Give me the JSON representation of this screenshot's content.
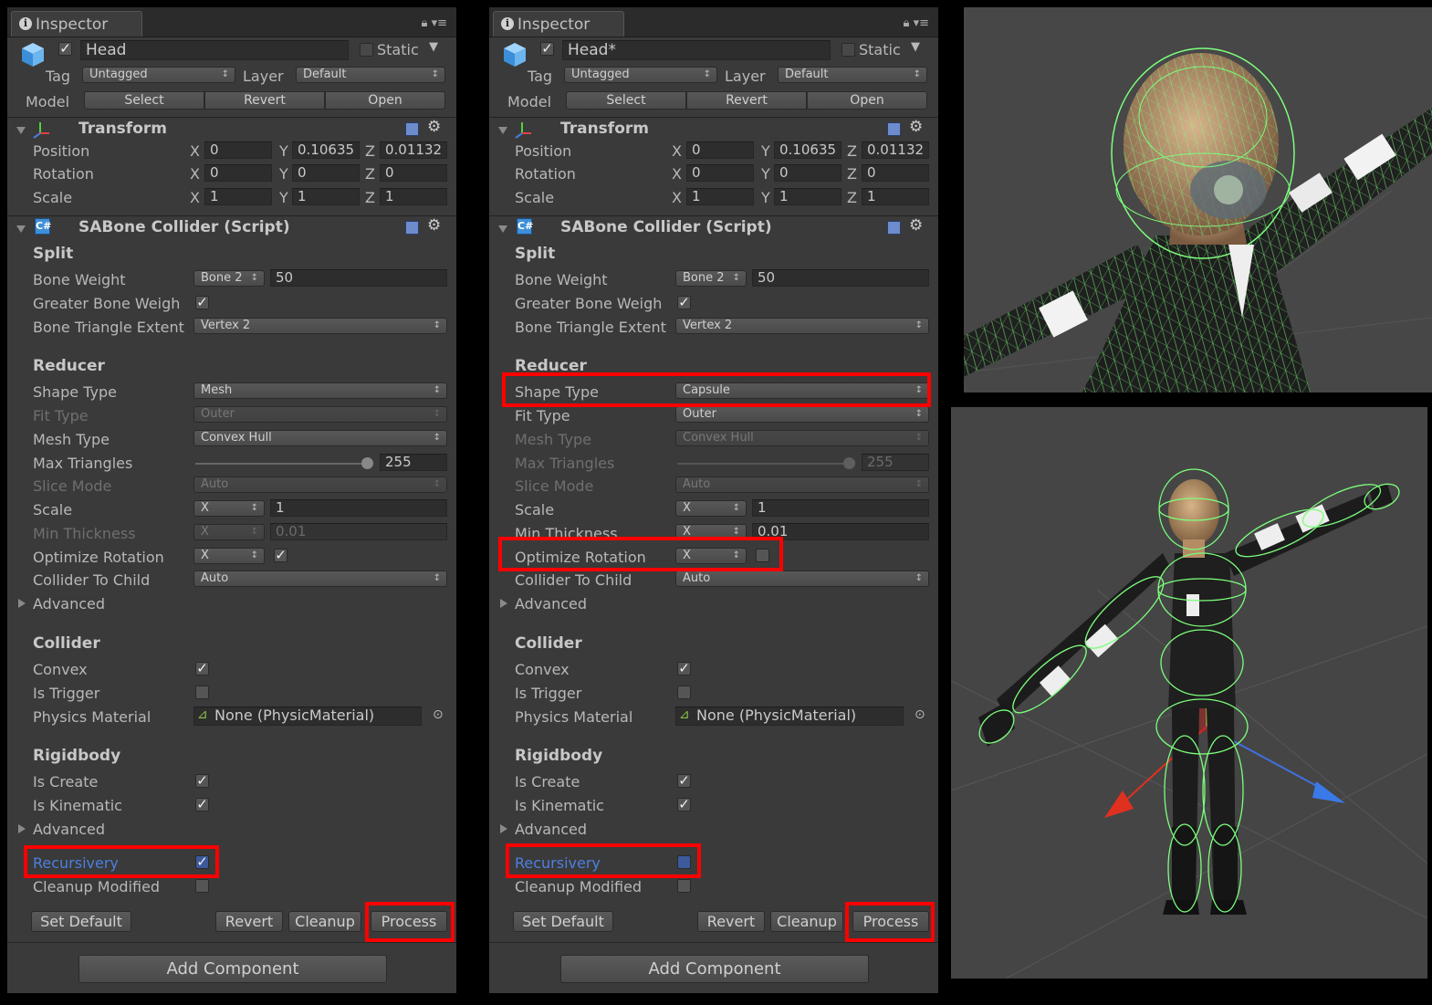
{
  "inspectors": [
    {
      "id": "left",
      "tab_label": "Inspector",
      "object_name": "Head",
      "static_label": "Static",
      "tag_label": "Tag",
      "tag_value": "Untagged",
      "layer_label": "Layer",
      "layer_value": "Default",
      "model_label": "Model",
      "model_buttons": [
        "Select",
        "Revert",
        "Open"
      ],
      "transform": {
        "title": "Transform",
        "rows": [
          {
            "label": "Position",
            "x": "0",
            "y": "0.10635",
            "z": "0.01132"
          },
          {
            "label": "Rotation",
            "x": "0",
            "y": "0",
            "z": "0"
          },
          {
            "label": "Scale",
            "x": "1",
            "y": "1",
            "z": "1"
          }
        ]
      },
      "script_title": "SABone Collider (Script)",
      "split": {
        "header": "Split",
        "bone_weight_label": "Bone Weight",
        "bone_weight_popup": "Bone 2",
        "bone_weight_value": "50",
        "greater_bone_weight_label": "Greater Bone Weigh",
        "greater_bone_weight_checked": true,
        "bone_triangle_extent_label": "Bone Triangle Extent",
        "bone_triangle_extent_value": "Vertex 2"
      },
      "reducer": {
        "header": "Reducer",
        "shape_type_label": "Shape Type",
        "shape_type_value": "Mesh",
        "fit_type_label": "Fit Type",
        "fit_type_value": "Outer",
        "fit_type_disabled": true,
        "mesh_type_label": "Mesh Type",
        "mesh_type_value": "Convex Hull",
        "mesh_type_disabled": false,
        "max_triangles_label": "Max Triangles",
        "max_triangles_value": "255",
        "max_triangles_disabled": false,
        "slice_mode_label": "Slice Mode",
        "slice_mode_value": "Auto",
        "scale_label": "Scale",
        "scale_axis": "X",
        "scale_value": "1",
        "min_thickness_label": "Min Thickness",
        "min_thickness_axis": "X",
        "min_thickness_value": "0.01",
        "min_thickness_disabled": true,
        "optimize_rotation_label": "Optimize Rotation",
        "optimize_rotation_axis": "X",
        "optimize_rotation_checked": true,
        "collider_to_child_label": "Collider To Child",
        "collider_to_child_value": "Auto",
        "advanced_label": "Advanced"
      },
      "collider": {
        "header": "Collider",
        "convex_label": "Convex",
        "convex_checked": true,
        "is_trigger_label": "Is Trigger",
        "is_trigger_checked": false,
        "physics_material_label": "Physics Material",
        "physics_material_value": "None (PhysicMaterial)"
      },
      "rigidbody": {
        "header": "Rigidbody",
        "is_create_label": "Is Create",
        "is_create_checked": true,
        "is_kinematic_label": "Is Kinematic",
        "is_kinematic_checked": true,
        "advanced_label": "Advanced"
      },
      "recursivery_label": "Recursivery",
      "recursivery_checked": true,
      "cleanup_modified_label": "Cleanup Modified",
      "cleanup_modified_checked": false,
      "buttons": {
        "set_default": "Set Default",
        "revert": "Revert",
        "cleanup": "Cleanup",
        "process": "Process"
      },
      "add_component": "Add Component"
    },
    {
      "id": "right",
      "tab_label": "Inspector",
      "object_name": "Head*",
      "static_label": "Static",
      "tag_label": "Tag",
      "tag_value": "Untagged",
      "layer_label": "Layer",
      "layer_value": "Default",
      "model_label": "Model",
      "model_buttons": [
        "Select",
        "Revert",
        "Open"
      ],
      "transform": {
        "title": "Transform",
        "rows": [
          {
            "label": "Position",
            "x": "0",
            "y": "0.10635",
            "z": "0.01132"
          },
          {
            "label": "Rotation",
            "x": "0",
            "y": "0",
            "z": "0"
          },
          {
            "label": "Scale",
            "x": "1",
            "y": "1",
            "z": "1"
          }
        ]
      },
      "script_title": "SABone Collider (Script)",
      "split": {
        "header": "Split",
        "bone_weight_label": "Bone Weight",
        "bone_weight_popup": "Bone 2",
        "bone_weight_value": "50",
        "greater_bone_weight_label": "Greater Bone Weigh",
        "greater_bone_weight_checked": true,
        "bone_triangle_extent_label": "Bone Triangle Extent",
        "bone_triangle_extent_value": "Vertex 2"
      },
      "reducer": {
        "header": "Reducer",
        "shape_type_label": "Shape Type",
        "shape_type_value": "Capsule",
        "fit_type_label": "Fit Type",
        "fit_type_value": "Outer",
        "fit_type_disabled": false,
        "mesh_type_label": "Mesh Type",
        "mesh_type_value": "Convex Hull",
        "mesh_type_disabled": true,
        "max_triangles_label": "Max Triangles",
        "max_triangles_value": "255",
        "max_triangles_disabled": true,
        "slice_mode_label": "Slice Mode",
        "slice_mode_value": "Auto",
        "scale_label": "Scale",
        "scale_axis": "X",
        "scale_value": "1",
        "min_thickness_label": "Min Thickness",
        "min_thickness_axis": "X",
        "min_thickness_value": "0.01",
        "min_thickness_disabled": false,
        "optimize_rotation_label": "Optimize Rotation",
        "optimize_rotation_axis": "X",
        "optimize_rotation_checked": false,
        "collider_to_child_label": "Collider To Child",
        "collider_to_child_value": "Auto",
        "advanced_label": "Advanced"
      },
      "collider": {
        "header": "Collider",
        "convex_label": "Convex",
        "convex_checked": true,
        "is_trigger_label": "Is Trigger",
        "is_trigger_checked": false,
        "physics_material_label": "Physics Material",
        "physics_material_value": "None (PhysicMaterial)"
      },
      "rigidbody": {
        "header": "Rigidbody",
        "is_create_label": "Is Create",
        "is_create_checked": true,
        "is_kinematic_label": "Is Kinematic",
        "is_kinematic_checked": true,
        "advanced_label": "Advanced"
      },
      "recursivery_label": "Recursivery",
      "recursivery_checked": false,
      "cleanup_modified_label": "Cleanup Modified",
      "cleanup_modified_checked": false,
      "buttons": {
        "set_default": "Set Default",
        "revert": "Revert",
        "cleanup": "Cleanup",
        "process": "Process"
      },
      "add_component": "Add Component"
    }
  ],
  "colors": {
    "panel_bg": "#3a3a3a",
    "highlight_red": "#ff0000",
    "wireframe_green": "#7cff7c",
    "label_blue": "#4d7fe0",
    "viewport_bg": "#454545"
  },
  "icons": [
    "info-icon",
    "lock-icon",
    "menu-icon",
    "cube-icon",
    "transform-axes-icon",
    "script-icon",
    "help-icon",
    "gear-icon",
    "object-picker-icon"
  ]
}
